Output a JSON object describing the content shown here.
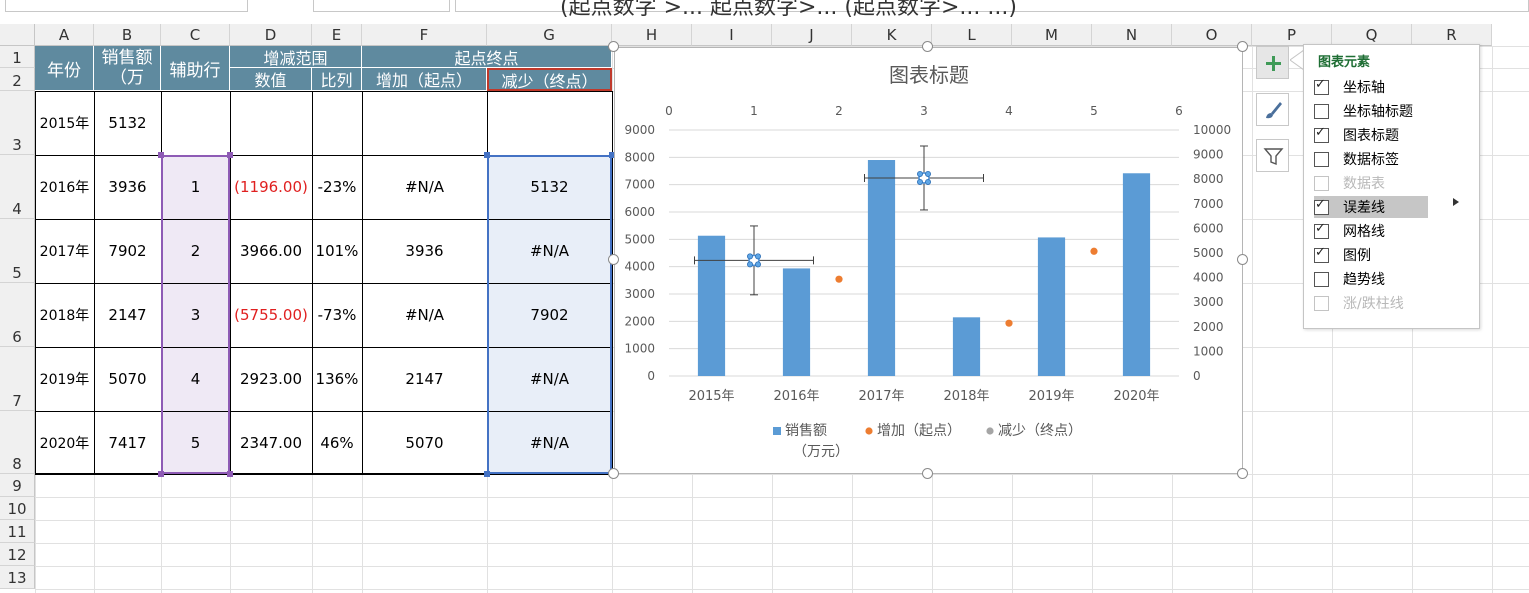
{
  "formula_bar": {
    "text": "(起点数字 >... 起点数字>... (起点数字>... ...)"
  },
  "columns": [
    "A",
    "B",
    "C",
    "D",
    "E",
    "F",
    "G",
    "H",
    "I",
    "J",
    "K",
    "L",
    "M",
    "N",
    "O",
    "P",
    "Q",
    "R"
  ],
  "rows": [
    "1",
    "2",
    "3",
    "4",
    "5",
    "6",
    "7",
    "8",
    "9",
    "10",
    "11",
    "12",
    "13"
  ],
  "table": {
    "headers": {
      "year": "年份",
      "sales": "销售额（万",
      "helper": "辅助行",
      "range": "增减范围",
      "startend": "起点终点",
      "value": "数值",
      "ratio": "比列",
      "increase": "增加（起点）",
      "decrease": "减少（终点）"
    },
    "data_rows": [
      {
        "year": "2015年",
        "sales": "5132",
        "helper": "",
        "value": "",
        "ratio": "",
        "increase": "",
        "decrease": ""
      },
      {
        "year": "2016年",
        "sales": "3936",
        "helper": "1",
        "value": "(1196.00)",
        "ratio": "-23%",
        "increase": "#N/A",
        "decrease": "5132"
      },
      {
        "year": "2017年",
        "sales": "7902",
        "helper": "2",
        "value": "3966.00",
        "ratio": "101%",
        "increase": "3936",
        "decrease": "#N/A"
      },
      {
        "year": "2018年",
        "sales": "2147",
        "helper": "3",
        "value": "(5755.00)",
        "ratio": "-73%",
        "increase": "#N/A",
        "decrease": "7902"
      },
      {
        "year": "2019年",
        "sales": "5070",
        "helper": "4",
        "value": "2923.00",
        "ratio": "136%",
        "increase": "2147",
        "decrease": "#N/A"
      },
      {
        "year": "2020年",
        "sales": "7417",
        "helper": "5",
        "value": "2347.00",
        "ratio": "46%",
        "increase": "5070",
        "decrease": "#N/A"
      }
    ],
    "negative_color": "#e02020",
    "header_color": "#5f8a9f"
  },
  "chart_data": {
    "type": "bar",
    "title": "图表标题",
    "categories": [
      "2015年",
      "2016年",
      "2017年",
      "2018年",
      "2019年",
      "2020年"
    ],
    "series": [
      {
        "name": "销售额（万元）",
        "type": "bar",
        "color": "#5b9bd5",
        "values": [
          5132,
          3936,
          7902,
          2147,
          5070,
          7417
        ]
      },
      {
        "name": "增加（起点）",
        "type": "scatter",
        "color": "#ed7d31",
        "points": [
          {
            "x": 1,
            "y": 4700
          },
          {
            "x": 2,
            "y": 3936
          },
          {
            "x": 3,
            "y": 8050
          },
          {
            "x": 4,
            "y": 2147
          },
          {
            "x": 5,
            "y": 5070
          }
        ]
      },
      {
        "name": "减少（终点）",
        "type": "scatter",
        "color": "#a5a5a5",
        "points": []
      }
    ],
    "error_bars": [
      {
        "x": 1,
        "y": 4700,
        "x_minus": 0.7,
        "x_plus": 0.7,
        "y_minus": 1400,
        "y_plus": 1400
      },
      {
        "x": 3,
        "y": 8050,
        "x_minus": 0.7,
        "x_plus": 0.7,
        "y_minus": 1300,
        "y_plus": 1300
      }
    ],
    "y_left": {
      "min": 0,
      "max": 9000,
      "ticks": [
        "0",
        "1000",
        "2000",
        "3000",
        "4000",
        "5000",
        "6000",
        "7000",
        "8000",
        "9000"
      ]
    },
    "y_right": {
      "min": 0,
      "max": 10000,
      "ticks": [
        "0",
        "1000",
        "2000",
        "3000",
        "4000",
        "5000",
        "6000",
        "7000",
        "8000",
        "9000",
        "10000"
      ]
    },
    "x_top": {
      "min": 0,
      "max": 6,
      "ticks": [
        "0",
        "1",
        "2",
        "3",
        "4",
        "5",
        "6"
      ]
    },
    "grid": true,
    "legend_position": "bottom",
    "legend": [
      "销售额",
      "（万元）",
      "增加（起点）",
      "减少（终点）"
    ]
  },
  "chart_elements_panel": {
    "title": "图表元素",
    "options": [
      {
        "label": "坐标轴",
        "checked": true,
        "disabled": false,
        "highlight": false
      },
      {
        "label": "坐标轴标题",
        "checked": false,
        "disabled": false,
        "highlight": false
      },
      {
        "label": "图表标题",
        "checked": true,
        "disabled": false,
        "highlight": false
      },
      {
        "label": "数据标签",
        "checked": false,
        "disabled": false,
        "highlight": false
      },
      {
        "label": "数据表",
        "checked": false,
        "disabled": true,
        "highlight": false
      },
      {
        "label": "误差线",
        "checked": true,
        "disabled": false,
        "highlight": true
      },
      {
        "label": "网格线",
        "checked": true,
        "disabled": false,
        "highlight": false
      },
      {
        "label": "图例",
        "checked": true,
        "disabled": false,
        "highlight": false
      },
      {
        "label": "趋势线",
        "checked": false,
        "disabled": false,
        "highlight": false
      },
      {
        "label": "涨/跌柱线",
        "checked": false,
        "disabled": true,
        "highlight": false
      }
    ]
  },
  "side_buttons": [
    "plus-icon",
    "brush-icon",
    "filter-icon"
  ]
}
